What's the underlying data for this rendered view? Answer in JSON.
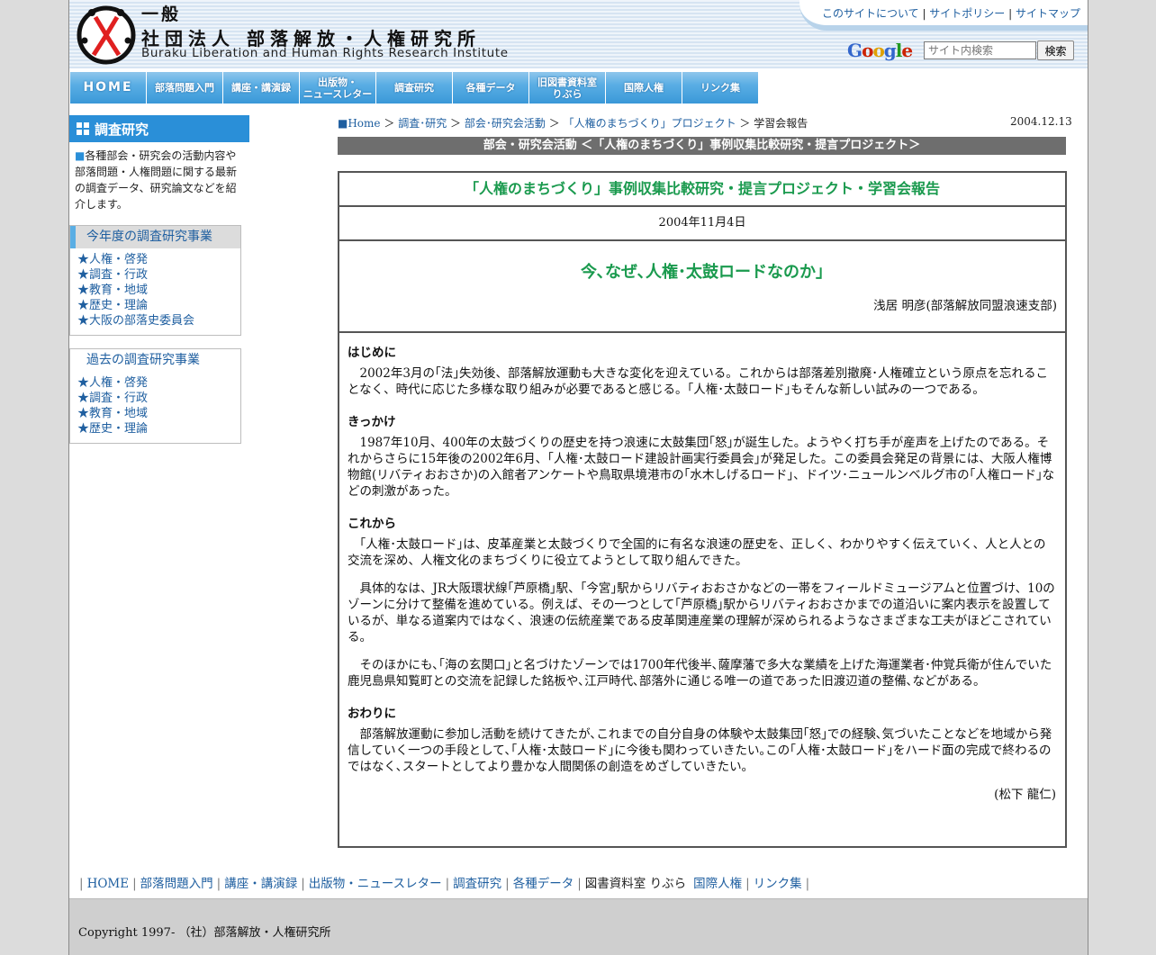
{
  "header": {
    "logo_line1": "一般",
    "logo_line2": "社団法人 部落解放・人権研究所",
    "logo_en": "Buraku Liberation and Human Rights Research Institute",
    "util_links": [
      "このサイトについて",
      "サイトポリシー",
      "サイトマップ"
    ],
    "search_brand": "Google",
    "search_placeholder": "サイト内検索",
    "search_button": "検索"
  },
  "nav": [
    {
      "label": "HOME"
    },
    {
      "label": "部落問題入門"
    },
    {
      "label": "講座・講演録"
    },
    {
      "label": "出版物・\nニュースレター"
    },
    {
      "label": "調査研究"
    },
    {
      "label": "各種データ"
    },
    {
      "label": "旧図書資料室\nりぶら"
    },
    {
      "label": "国際人権"
    },
    {
      "label": "リンク集"
    }
  ],
  "sidebar": {
    "heading": "調査研究",
    "desc_marker": "■",
    "desc": "各種部会・研究会の活動内容や部落問題・人権問題に関する最新の調査データ、研究論文などを紹介します。",
    "current_title": "今年度の調査研究事業",
    "current_items": [
      "人権・啓発",
      "調査・行政",
      "教育・地域",
      "歴史・理論",
      "大阪の部落史委員会"
    ],
    "past_title": "過去の調査研究事業",
    "past_items": [
      "人権・啓発",
      "調査・行政",
      "教育・地域",
      "歴史・理論"
    ],
    "star": "★"
  },
  "breadcrumb": {
    "home": "■Home",
    "sep": "＞",
    "items": [
      "調査･研究",
      "部会･研究会活動",
      "「人権のまちづくり」プロジェクト"
    ],
    "current": "学習会報告",
    "date": "2004.12.13"
  },
  "section_bar": "部会・研究会活動 ＜「人権のまちづくり」事例収集比較研究・提言プロジェクト＞",
  "article": {
    "title": "「人権のまちづくり」事例収集比較研究・提言プロジェクト・学習会報告",
    "date": "2004年11月4日",
    "heading": "今､なぜ､人権･太鼓ロードなのか｣",
    "author": "浅居 明彦(部落解放同盟浪速支部)",
    "s1_title": "はじめに",
    "s1_p1": "　2002年3月の｢法｣失効後、部落解放運動も大きな変化を迎えている。これからは部落差別撤廃･人権確立という原点を忘れることなく、時代に応じた多様な取り組みが必要であると感じる。｢人権･太鼓ロード｣もそんな新しい試みの一つである。",
    "s2_title": "きっかけ",
    "s2_p1": "　1987年10月、400年の太鼓づくりの歴史を持つ浪速に太鼓集団｢怒｣が誕生した。ようやく打ち手が産声を上げたのである。それからさらに15年後の2002年6月、｢人権･太鼓ロード建設計画実行委員会｣が発足した。この委員会発足の背景には、大阪人権博物館(リバティおおさか)の入館者アンケートや鳥取県境港市の｢水木しげるロード｣、ドイツ･ニュールンベルグ市の｢人権ロード｣などの刺激があった。",
    "s3_title": "これから",
    "s3_p1": "　｢人権･太鼓ロード｣は、皮革産業と太鼓づくりで全国的に有名な浪速の歴史を、正しく、わかりやすく伝えていく、人と人との交流を深め、人権文化のまちづくりに役立てようとして取り組んできた。",
    "s3_p2": "　具体的なは、JR大阪環状線｢芦原橋｣駅、｢今宮｣駅からリバティおおさかなどの一帯をフィールドミュージアムと位置づけ、10のゾーンに分けて整備を進めている。例えば、その一つとして｢芦原橋｣駅からリバティおおさかまでの道沿いに案内表示を設置しているが、単なる道案内ではなく、浪速の伝統産業である皮革関連産業の理解が深められるようなさまざまな工夫がほどこされている。",
    "s3_p3": "　そのほかにも､｢海の玄関口｣と名づけたゾーンでは1700年代後半､薩摩藩で多大な業績を上げた海運業者･仲覚兵衛が住んでいた鹿児島県知覧町との交流を記録した銘板や､江戸時代､部落外に通じる唯一の道であった旧渡辺道の整備､などがある。",
    "s4_title": "おわりに",
    "s4_p1": "　部落解放運動に参加し活動を続けてきたが､これまでの自分自身の体験や太鼓集団｢怒｣での経験､気づいたことなどを地域から発信していく一つの手段として､｢人権･太鼓ロード｣に今後も関わっていきたい｡この｢人権･太鼓ロード｣をハード面の完成で終わるのではなく､スタートとしてより豊かな人間関係の創造をめざしていきたい｡",
    "sign": "(松下 龍仁)"
  },
  "footer": {
    "links": [
      "HOME",
      "部落問題入門",
      "講座・講演録",
      "出版物・ニュースレター",
      "調査研究",
      "各種データ"
    ],
    "plain": "図書資料室 りぶら",
    "links2": [
      "国際人権",
      "リンク集"
    ],
    "copyright": "Copyright 1997- （社）部落解放・人権研究所"
  }
}
